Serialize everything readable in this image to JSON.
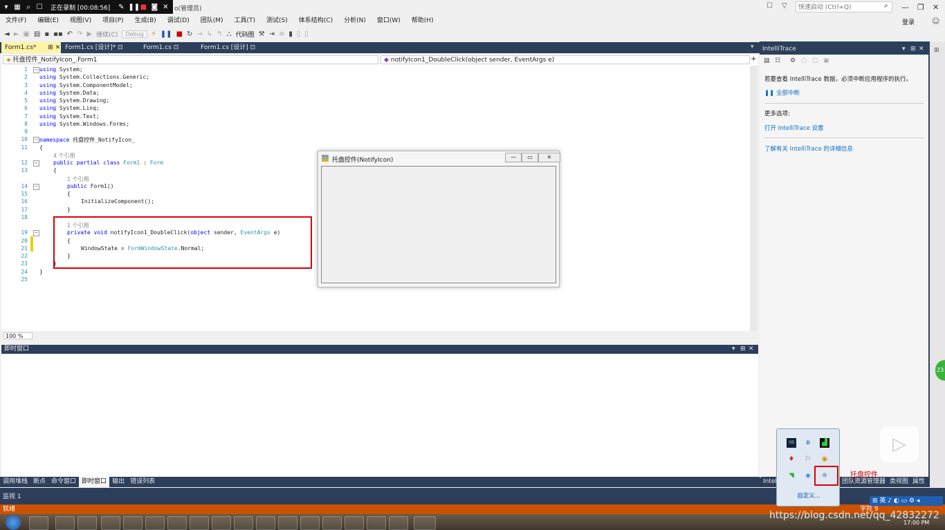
{
  "recording": {
    "status": "正在录制 [00:08:56]"
  },
  "window": {
    "title_fragment": "o(管理员)"
  },
  "menu": [
    "文件(F)",
    "编辑(E)",
    "视图(V)",
    "项目(P)",
    "生成(B)",
    "调试(D)",
    "团队(M)",
    "工具(T)",
    "测试(S)",
    "体系结构(C)",
    "分析(N)",
    "窗口(W)",
    "帮助(H)"
  ],
  "quick_launch": {
    "placeholder": "快速启动 (Ctrl+Q)"
  },
  "account": {
    "login": "登录"
  },
  "toolbar": {
    "continue": "继续(C)",
    "config": "Debug",
    "code_map": "代码图"
  },
  "tabs": [
    {
      "label": "Form1.cs*",
      "active": true
    },
    {
      "label": "Form1.cs [设计]*",
      "active": false
    },
    {
      "label": "Form1.cs",
      "active": false
    },
    {
      "label": "Form1.cs [设计]",
      "active": false
    }
  ],
  "nav": {
    "class": "托盘控件_NotifyIcon_.Form1",
    "member": "notifyIcon1_DoubleClick(object sender, EventArgs e)"
  },
  "code": {
    "line_numbers": [
      "1",
      "2",
      "3",
      "4",
      "5",
      "6",
      "7",
      "8",
      "9",
      "10",
      "11",
      "12",
      "13",
      "14",
      "15",
      "16",
      "17",
      "18",
      "19",
      "20",
      "21",
      "22",
      "23",
      "24",
      "25"
    ],
    "using_lines": [
      "System;",
      "System.Collections.Generic;",
      "System.ComponentModel;",
      "System.Data;",
      "System.Drawing;",
      "System.Linq;",
      "System.Text;",
      "System.Windows.Forms;"
    ],
    "kw_using": "using",
    "kw_namespace": "namespace",
    "namespace_name": "托盘控件_NotifyIcon_",
    "ref4": "4 个引用",
    "ref1": "1 个引用",
    "class_decl_kw": "public partial class",
    "class_name": "Form1",
    "base_class": "Form",
    "ctor_kw": "public",
    "ctor_name": "Form1()",
    "init_call": "InitializeComponent();",
    "method_kw": "private void",
    "method_name": "notifyIcon1_DoubleClick(",
    "param1_kw": "object",
    "param1": "sender,",
    "param2_type": "EventArgs",
    "param2": "e)",
    "assign_lhs": "WindowState =",
    "assign_type": "FormWindowState",
    "assign_rhs": ".Normal;",
    "open_brace": "{",
    "close_brace": "}",
    "colon": ":"
  },
  "zoom": "100 %",
  "form_window": {
    "title": "托盘控件(NotifyIcon)"
  },
  "immediate": {
    "title": "即时窗口"
  },
  "bottom_tabs": [
    "调用堆栈",
    "断点",
    "命令窗口",
    "即时窗口",
    "输出",
    "错误列表"
  ],
  "watch": {
    "label": "监视 1"
  },
  "status": {
    "text": "就绪",
    "col": "字符 9"
  },
  "intellitrace": {
    "title": "IntelliTrace",
    "hint": "若要查看 IntelliTrace 数据，必须中断应用程序的执行。",
    "break_all": "全部中断",
    "more_options": "更多选项:",
    "open_settings": "打开 IntelliTrace 设置",
    "learn_more": "了解有关 IntelliTrace 的详细信息"
  },
  "right_tabs": [
    "Intel",
    "团队资源管理器",
    "类视图",
    "属性"
  ],
  "tray_popup": {
    "customize": "自定义..."
  },
  "tray_caption": "托盘控件",
  "side_badge": "23",
  "watermark": "https://blog.csdn.net/qq_42832272",
  "clock": "17:00 PM",
  "ime": "英"
}
